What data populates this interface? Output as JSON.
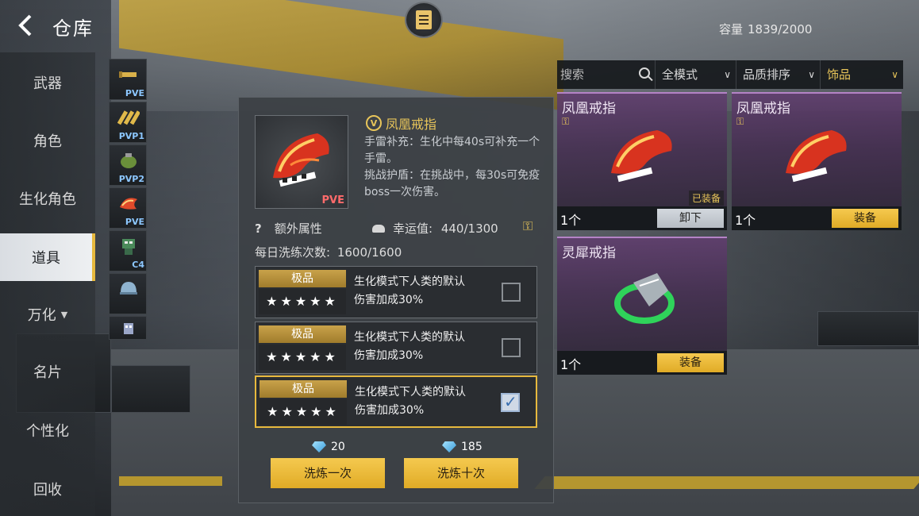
{
  "header": {
    "title": "仓库",
    "capacity_label": "容量",
    "capacity_value": "1839/2000"
  },
  "nav": {
    "items": [
      {
        "label": "武器"
      },
      {
        "label": "角色"
      },
      {
        "label": "生化角色"
      },
      {
        "label": "道具"
      },
      {
        "label": "万化"
      },
      {
        "label": "名片"
      },
      {
        "label": "个性化"
      },
      {
        "label": "回收"
      }
    ],
    "active_index": 3
  },
  "subtabs": [
    {
      "tag": "PVE"
    },
    {
      "tag": "PVP1"
    },
    {
      "tag": "PVP2"
    },
    {
      "tag": "PVE"
    },
    {
      "tag": "C4"
    },
    {
      "tag": ""
    },
    {
      "tag": ""
    }
  ],
  "detail": {
    "name": "凤凰戒指",
    "badge": "V",
    "mode_tag": "PVE",
    "desc_1": "手雷补充：生化中每40s可补充一个手雷。",
    "desc_2": "挑战护盾：在挑战中，每30s可免疫boss一次伤害。",
    "extra_label": "额外属性",
    "luck_label": "幸运值:",
    "luck_value": "440/1300",
    "daily_label": "每日洗练次数:",
    "daily_value": "1600/1600",
    "options": [
      {
        "grade": "极品",
        "stars": "★★★★★",
        "line1": "生化模式下人类的默认",
        "line2": "伤害加成30%",
        "checked": false
      },
      {
        "grade": "极品",
        "stars": "★★★★★",
        "line1": "生化模式下人类的默认",
        "line2": "伤害加成30%",
        "checked": false
      },
      {
        "grade": "极品",
        "stars": "★★★★★",
        "line1": "生化模式下人类的默认",
        "line2": "伤害加成30%",
        "checked": true
      }
    ],
    "cost_once": "20",
    "cost_ten": "185",
    "btn_once": "洗炼一次",
    "btn_ten": "洗炼十次"
  },
  "filters": {
    "search_placeholder": "搜索",
    "mode": "全模式",
    "sort": "品质排序",
    "category": "饰品"
  },
  "cards": [
    {
      "name": "凤凰戒指",
      "count": "1个",
      "action": "卸下",
      "equipped_label": "已装备"
    },
    {
      "name": "凤凰戒指",
      "count": "1个",
      "action": "装备"
    },
    {
      "name": "灵犀戒指",
      "count": "1个",
      "action": "装备"
    }
  ],
  "colors": {
    "accent_gold": "#e7b93e",
    "rarity_purple": "#b483c6"
  }
}
